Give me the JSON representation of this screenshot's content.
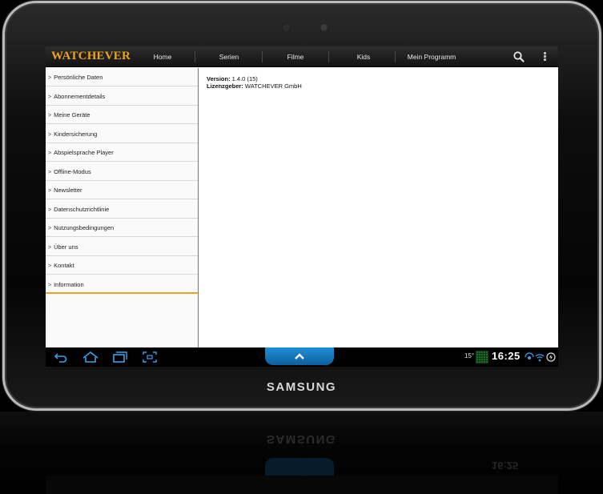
{
  "app": {
    "logo": "WATCHEVER",
    "accent_color": "#f0a21b"
  },
  "nav": {
    "home": "Home",
    "serien": "Serien",
    "filme": "Filme",
    "kids": "Kids",
    "mein_programm": "Mein Programm",
    "search_icon": "search-icon",
    "overflow_icon": "overflow-menu-icon"
  },
  "sidebar": {
    "items": [
      {
        "label": "Persönliche Daten"
      },
      {
        "label": "Abonnementdetails"
      },
      {
        "label": "Meine Geräte"
      },
      {
        "label": "Kindersicherung"
      },
      {
        "label": "Abspielsprache Player"
      },
      {
        "label": "Offline-Modus"
      },
      {
        "label": "Newsletter"
      },
      {
        "label": "Datenschutzrichtlinie"
      },
      {
        "label": "Nutzungsbedingungen"
      },
      {
        "label": "Über uns"
      },
      {
        "label": "Kontakt"
      },
      {
        "label": "Information",
        "active": true
      }
    ]
  },
  "content": {
    "version_label": "Version:",
    "version_value": " 1.4.0 (15)",
    "licensor_label": "Lizenzgeber:",
    "licensor_value": " WATCHEVER GmbH"
  },
  "system_bar": {
    "temperature": "15°",
    "time": "16:25",
    "accent_color": "#1e8fd6"
  },
  "device": {
    "brand": "SAMSUNG"
  }
}
